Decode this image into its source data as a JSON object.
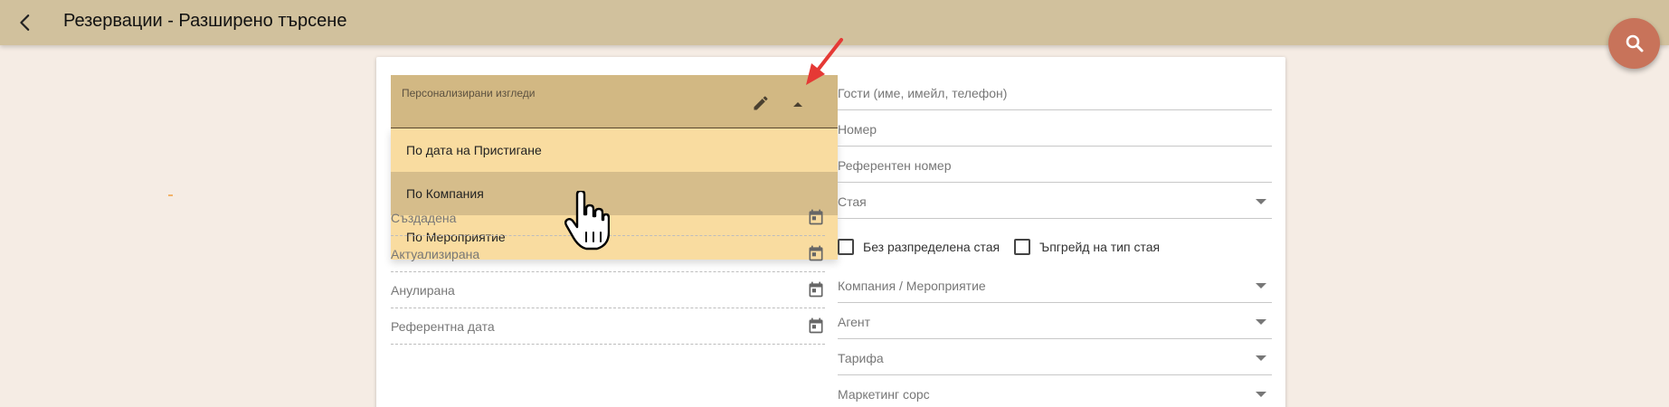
{
  "header": {
    "title": "Резервации - Разширено търсене"
  },
  "views_dropdown": {
    "label": "Персонализирани изгледи",
    "options": [
      {
        "label": "По дата на Пристигане"
      },
      {
        "label": "По Компания"
      },
      {
        "label": "По Мероприятие"
      }
    ],
    "highlighted_option": "По Компания"
  },
  "date_fields": [
    {
      "label": "Създадена"
    },
    {
      "label": "Актуализирана"
    },
    {
      "label": "Анулирана"
    },
    {
      "label": "Референтна дата"
    }
  ],
  "right_fields": {
    "guests": "Гости (име, имейл, телефон)",
    "number": "Номер",
    "reference_number": "Референтен номер",
    "room": "Стая",
    "company_event": "Компания / Мероприятие",
    "agent": "Агент",
    "rate": "Тарифа",
    "marketing_source": "Маркетинг сорс"
  },
  "checkboxes": {
    "no_room": "Без разпределена стая",
    "upgrade": "Ъпгрейд на тип стая"
  },
  "icons": {
    "back": "arrow-left-icon",
    "search": "search-icon",
    "edit": "pencil-icon",
    "caret": "caret-up-icon",
    "calendar": "calendar-icon"
  },
  "colors": {
    "topbar": "#d1c19d",
    "fab": "#c8735a",
    "dropdown_trigger": "#d2b883",
    "dropdown_panel": "#f9dca0",
    "dropdown_active": "#d6bd8b",
    "annotation_arrow": "#e53935"
  }
}
